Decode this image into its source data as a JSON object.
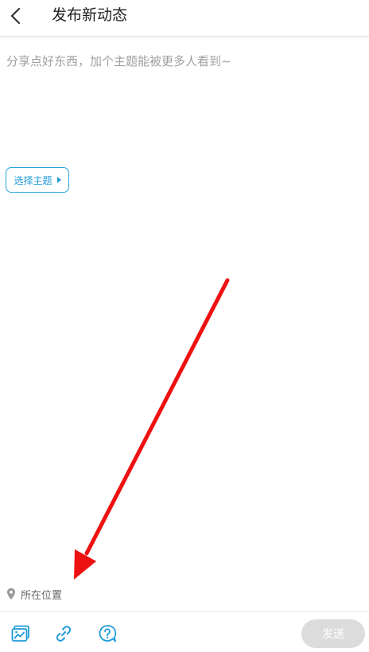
{
  "header": {
    "title": "发布新动态",
    "back_icon": "chevron-left-icon"
  },
  "composer": {
    "placeholder": "分享点好东西，加个主题能被更多人看到~",
    "value": ""
  },
  "topic": {
    "label": "选择主题",
    "icon": "triangle-right-icon"
  },
  "location": {
    "label": "所在位置",
    "icon": "location-pin-icon"
  },
  "toolbar": {
    "tools": [
      {
        "icon": "image-icon"
      },
      {
        "icon": "link-icon"
      },
      {
        "icon": "question-bubble-icon"
      }
    ],
    "send_label": "发送"
  },
  "colors": {
    "accent": "#1f9bd9",
    "annotation_arrow": "#ee1111",
    "send_disabled": "#dcdcdc"
  }
}
